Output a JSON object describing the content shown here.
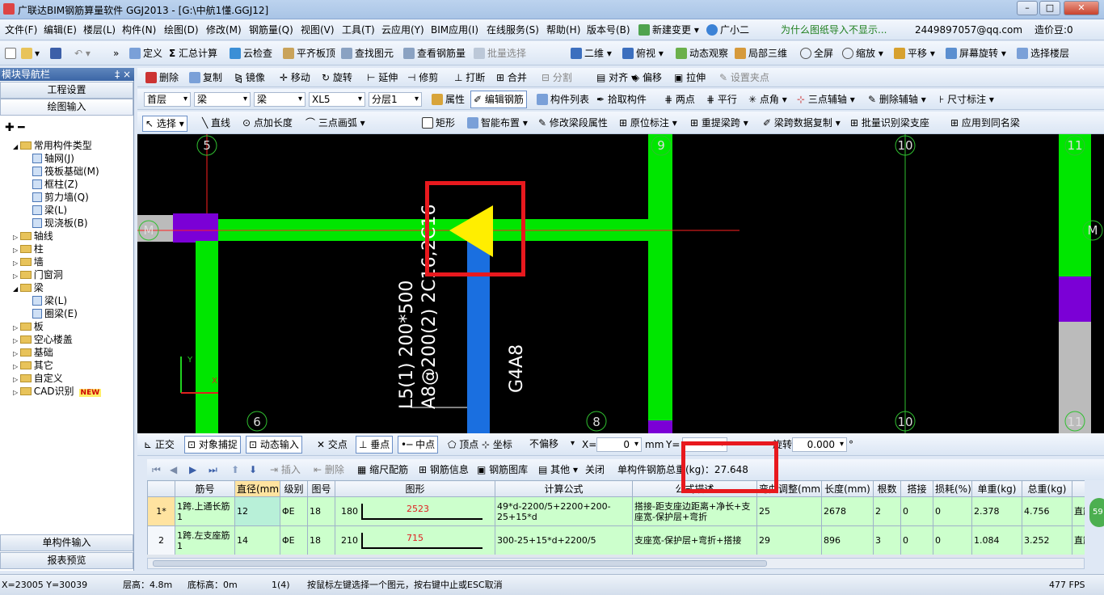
{
  "window": {
    "title": "广联达BIM钢筋算量软件 GGJ2013 - [G:\\中航1懂.GGJ12]"
  },
  "menu": [
    "文件(F)",
    "编辑(E)",
    "楼层(L)",
    "构件(N)",
    "绘图(D)",
    "修改(M)",
    "钢筋量(Q)",
    "视图(V)",
    "工具(T)",
    "云应用(Y)",
    "BIM应用(I)",
    "在线服务(S)",
    "帮助(H)",
    "版本号(B)",
    "新建变更",
    "广小二"
  ],
  "menu_notice": "为什么图纸导入不显示...",
  "menu_account": "2449897057@qq.com",
  "menu_beans": "造价豆:0",
  "toolbar1": [
    "定义",
    "汇总计算",
    "云检查",
    "平齐板顶",
    "查找图元",
    "查看钢筋量",
    "批量选择",
    "二维",
    "俯视",
    "动态观察",
    "局部三维",
    "全屏",
    "缩放",
    "平移",
    "屏幕旋转",
    "选择楼层"
  ],
  "toolbar2": [
    "删除",
    "复制",
    "镜像",
    "移动",
    "旋转",
    "延伸",
    "修剪",
    "打断",
    "合并",
    "分割",
    "对齐",
    "偏移",
    "拉伸",
    "设置夹点"
  ],
  "toolbar3": {
    "floor": "首层",
    "cat": "梁",
    "type": "梁",
    "comp": "XL5",
    "layer": "分层1",
    "buttons": [
      "属性",
      "编辑钢筋",
      "构件列表",
      "拾取构件",
      "两点",
      "平行",
      "点角",
      "三点辅轴",
      "删除辅轴",
      "尺寸标注"
    ]
  },
  "toolbar4": [
    "选择",
    "直线",
    "点加长度",
    "三点画弧",
    "矩形",
    "智能布置",
    "修改梁段属性",
    "原位标注",
    "重提梁跨",
    "梁跨数据复制",
    "批量识别梁支座",
    "应用到同名梁"
  ],
  "nav": {
    "header": "模块导航栏",
    "pin": "‡ ×",
    "top_buttons": [
      "工程设置",
      "绘图输入"
    ],
    "tree": [
      {
        "label": "常用构件类型",
        "level": 0,
        "kind": "folder"
      },
      {
        "label": "轴网(J)",
        "level": 1,
        "kind": "leaf"
      },
      {
        "label": "筏板基础(M)",
        "level": 1,
        "kind": "leaf"
      },
      {
        "label": "框柱(Z)",
        "level": 1,
        "kind": "leaf"
      },
      {
        "label": "剪力墙(Q)",
        "level": 1,
        "kind": "leaf"
      },
      {
        "label": "梁(L)",
        "level": 1,
        "kind": "leaf"
      },
      {
        "label": "现浇板(B)",
        "level": 1,
        "kind": "leaf"
      },
      {
        "label": "轴线",
        "level": 0,
        "kind": "folder"
      },
      {
        "label": "柱",
        "level": 0,
        "kind": "folder"
      },
      {
        "label": "墙",
        "level": 0,
        "kind": "folder"
      },
      {
        "label": "门窗洞",
        "level": 0,
        "kind": "folder"
      },
      {
        "label": "梁",
        "level": 0,
        "kind": "folder"
      },
      {
        "label": "梁(L)",
        "level": 1,
        "kind": "leaf"
      },
      {
        "label": "圈梁(E)",
        "level": 1,
        "kind": "leaf"
      },
      {
        "label": "板",
        "level": 0,
        "kind": "folder"
      },
      {
        "label": "空心楼盖",
        "level": 0,
        "kind": "folder"
      },
      {
        "label": "基础",
        "level": 0,
        "kind": "folder"
      },
      {
        "label": "其它",
        "level": 0,
        "kind": "folder"
      },
      {
        "label": "自定义",
        "level": 0,
        "kind": "folder"
      },
      {
        "label": "CAD识别",
        "level": 0,
        "kind": "folder",
        "badge": "NEW"
      }
    ],
    "bottom_buttons": [
      "单构件输入",
      "报表预览"
    ]
  },
  "canvas": {
    "axis_labels": {
      "top": [
        "5",
        "9",
        "10",
        "11"
      ],
      "bottom": [
        "6",
        "8",
        "10",
        "11"
      ],
      "left": "M",
      "right": "M"
    },
    "beam_text_1": "L5(1) 200*500",
    "beam_text_2": "A8@200(2) 2C16;2C16",
    "beam_text_3": "G4A8",
    "ucs_y": "Y",
    "ucs_x": "X",
    "colors": {
      "beam": "#00e600",
      "column": "#7b00d6",
      "blue_beam": "#1a6fe0",
      "arrow": "#ffee00",
      "grid": "#ff2020",
      "highlight": "#e8191e"
    }
  },
  "snapbar": {
    "items": [
      "正交",
      "对象捕捉",
      "动态输入",
      "交点",
      "垂点",
      "中点",
      "顶点",
      "坐标"
    ],
    "offset": "不偏移",
    "x_label": "X=",
    "x_value": "0",
    "unit": "mm",
    "y_label": "Y=",
    "rotate_label": "旋转",
    "rotate_value": "0.000",
    "degree": "°"
  },
  "gridtb": {
    "buttons": [
      "插入",
      "删除",
      "缩尺配筋",
      "钢筋信息",
      "钢筋图库",
      "其他",
      "关闭"
    ],
    "total_label": "单构件钢筋总重(kg)：27.648"
  },
  "table": {
    "headers": [
      "",
      "筋号",
      "直径(mm)",
      "级别",
      "图号",
      "图形",
      "计算公式",
      "公式描述",
      "弯曲调整(mm)",
      "长度(mm)",
      "根数",
      "搭接",
      "损耗(%)",
      "单重(kg)",
      "总重(kg)",
      "钢"
    ],
    "rows": [
      {
        "no": "1*",
        "name": "1跨.上通长筋1",
        "dia": "12",
        "grade": "ΦE",
        "fig": "18",
        "shape_l": "180",
        "shape_v": "2523",
        "formula": "49*d-2200/5+2200+200-25+15*d",
        "desc": "搭接-距支座边距离+净长+支座宽-保护层+弯折",
        "bend": "25",
        "len": "2678",
        "qty": "2",
        "lap": "0",
        "loss": "0",
        "unit_w": "2.378",
        "total_w": "4.756",
        "extra": "直筋"
      },
      {
        "no": "2",
        "name": "1跨.左支座筋1",
        "dia": "14",
        "grade": "ΦE",
        "fig": "18",
        "shape_l": "210",
        "shape_v": "715",
        "formula": "300-25+15*d+2200/5",
        "desc": "支座宽-保护层+弯折+搭接",
        "bend": "29",
        "len": "896",
        "qty": "3",
        "lap": "0",
        "loss": "0",
        "unit_w": "1.084",
        "total_w": "3.252",
        "extra": "直筋"
      }
    ]
  },
  "status": {
    "coords": "X=23005 Y=30039",
    "floor_h": "层高：4.8m",
    "bottom_h": "底标高：0m",
    "count": "1(4)",
    "hint": "按鼠标左键选择一个图元，按右键中止或ESC取消",
    "fps": "477 FPS"
  }
}
